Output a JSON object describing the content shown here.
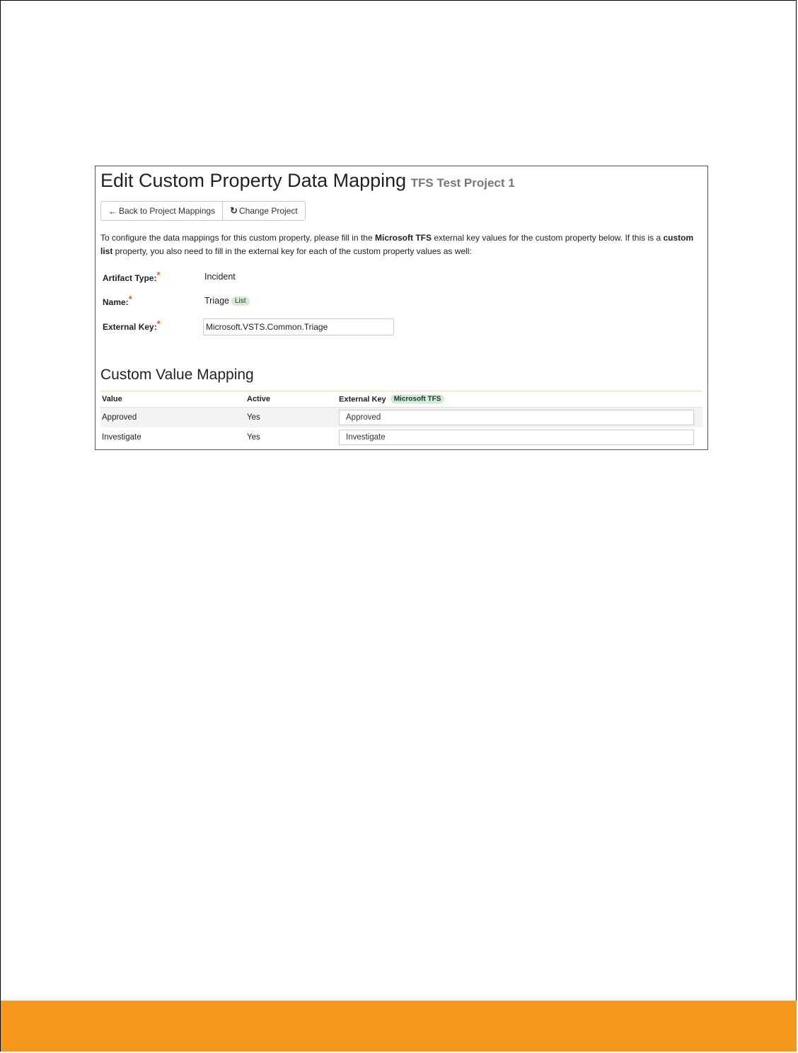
{
  "header": {
    "title": "Edit Custom Property Data Mapping",
    "project": "TFS Test Project 1"
  },
  "toolbar": {
    "back_label": "Back to Project Mappings",
    "change_label": "Change Project"
  },
  "intro": {
    "p1": "To configure the data mappings for this custom property, please fill in the ",
    "b1": "Microsoft TFS",
    "p2": " external key values for the custom property below. If this is a ",
    "b2": "custom list",
    "p3": " property, you also need to fill in the external key for each of the custom property values as well:"
  },
  "form": {
    "artifact_type_label": "Artifact Type:",
    "artifact_type_value": "Incident",
    "name_label": "Name:",
    "name_value": "Triage",
    "name_badge": "List",
    "external_key_label": "External Key:",
    "external_key_value": "Microsoft.VSTS.Common.Triage",
    "required_marker": "*"
  },
  "mapping": {
    "title": "Custom Value Mapping",
    "columns": {
      "value": "Value",
      "active": "Active",
      "external_key": "External Key",
      "external_key_badge": "Microsoft TFS"
    },
    "rows": [
      {
        "value": "Approved",
        "active": "Yes",
        "external_key": "Approved"
      },
      {
        "value": "Investigate",
        "active": "Yes",
        "external_key": "Investigate"
      }
    ]
  },
  "colors": {
    "footer_bar": "#f7981c",
    "required": "#e8591c",
    "badge_bg": "#d4ecd2"
  }
}
